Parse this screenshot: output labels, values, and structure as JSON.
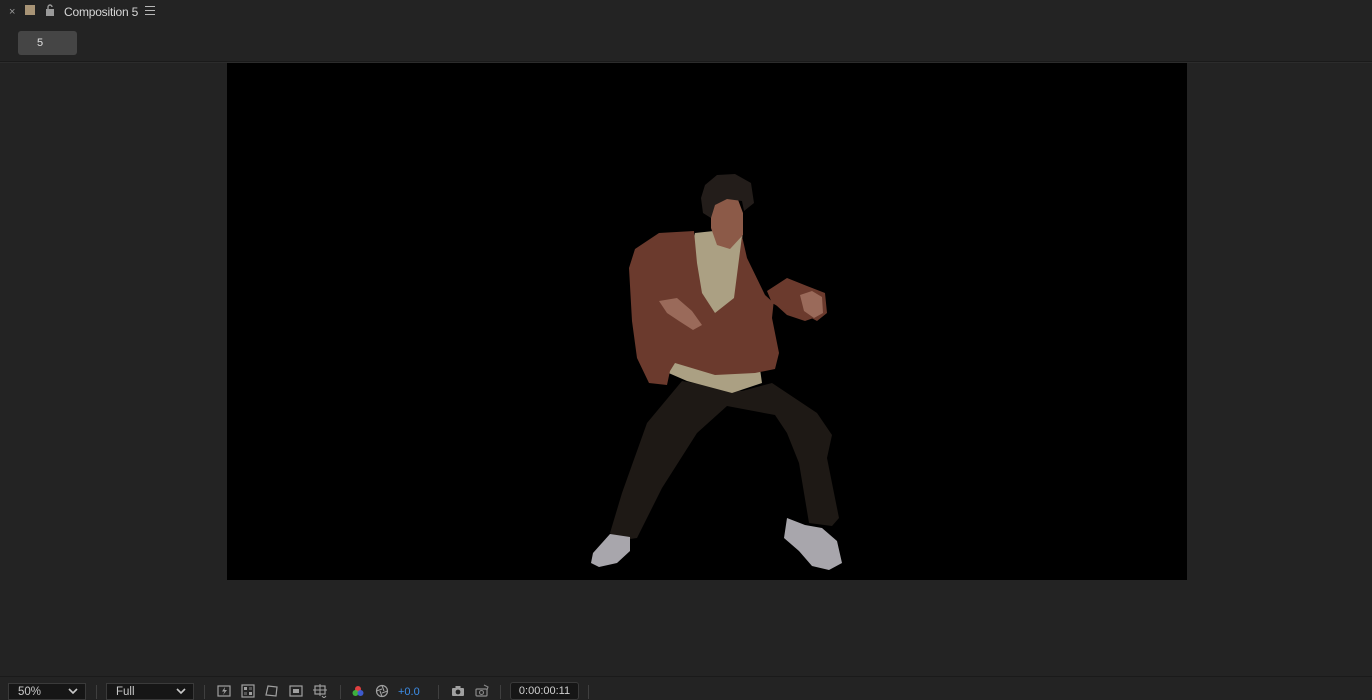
{
  "tab": {
    "close_glyph": "×",
    "title": "Composition 5",
    "swatch_color": "#a89476",
    "icons": [
      "close-icon",
      "color-swatch-icon",
      "lock-icon",
      "hamburger-menu-icon"
    ]
  },
  "comp_button": {
    "label": "5"
  },
  "viewer": {
    "background": "#000000",
    "content": "silhouette-dancer-illustration"
  },
  "footer": {
    "zoom": "50%",
    "resolution": "Full",
    "exposure": "+0.0",
    "timecode": "0:00:00:11",
    "icons": [
      "fast-previews-icon",
      "transparency-grid-icon",
      "mask-path-icon",
      "region-of-interest-icon",
      "guides-icon",
      "channel-icon",
      "reset-exposure-icon",
      "snapshot-icon",
      "show-snapshot-icon"
    ]
  },
  "colors": {
    "panel_bg": "#232323",
    "accent_blue": "#3d8ee8"
  }
}
